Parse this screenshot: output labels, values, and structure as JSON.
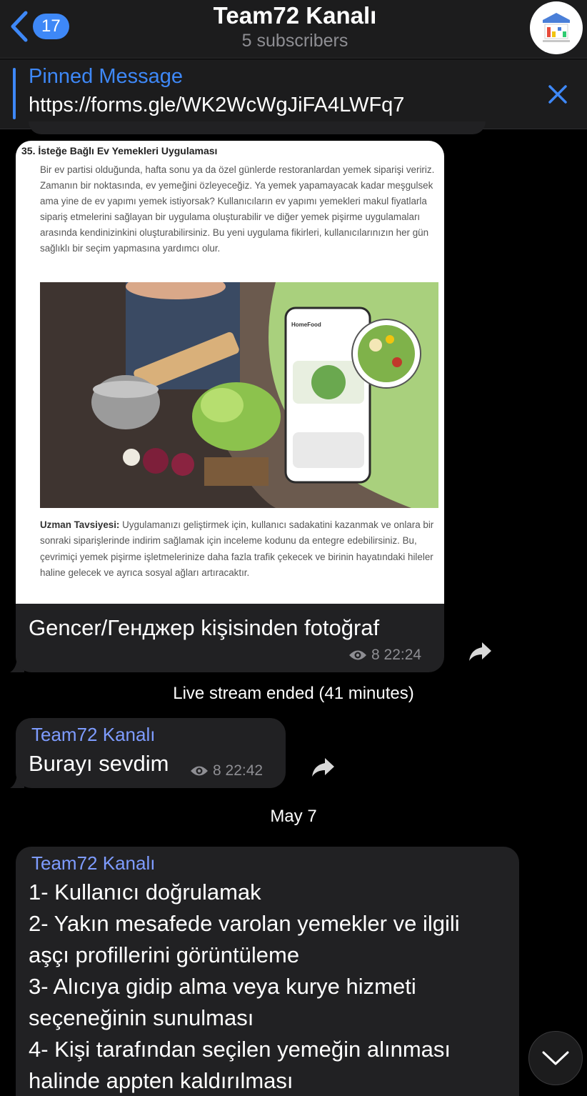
{
  "header": {
    "back_count": "17",
    "title": "Team72 Kanalı",
    "subtitle": "5 subscribers"
  },
  "pinned": {
    "label": "Pinned Message",
    "text": "https://forms.gle/WK2WcWgJiFA4LWFq7"
  },
  "photo_message": {
    "doc": {
      "title": "35. İsteğe Bağlı Ev Yemekleri Uygulaması",
      "body": "Bir ev partisi olduğunda, hafta sonu ya da özel günlerde restoranlardan yemek siparişi veririz. Zamanın bir noktasında, ev yemeğini özleyeceğiz. Ya yemek yapamayacak kadar meşgulsek ama yine de ev yapımı yemek istiyorsak? Kullanıcıların ev yapımı yemekleri makul fiyatlarla sipariş etmelerini sağlayan bir uygulama oluşturabilir ve diğer yemek pişirme uygulamaları arasında kendinizinkini oluşturabilirsiniz. Bu yeni uygulama fikirleri, kullanıcılarınızın her gün sağlıklı bir seçim yapmasına yardımcı olur.",
      "app_name": "HomeFood",
      "tip_label": "Uzman Tavsiyesi:",
      "tip_text": "Uygulamanızı geliştirmek için, kullanıcı sadakatini kazanmak ve onlara bir sonraki siparişlerinde indirim sağlamak için inceleme kodunu da entegre edebilirsiniz. Bu, çevrimiçi yemek pişirme işletmelerinize daha fazla trafik çekecek ve birinin hayatındaki hileler haline gelecek ve ayrıca sosyal ağları artıracaktır."
    },
    "caption": "Gencer/Генджер kişisinden fotoğraf",
    "views": "8",
    "time": "22:24"
  },
  "service_message": "Live stream ended (41 minutes)",
  "message2": {
    "author": "Team72 Kanalı",
    "text": "Burayı sevdim",
    "views": "8",
    "time": "22:42"
  },
  "date_separator": "May 7",
  "message3": {
    "author": "Team72 Kanalı",
    "lines": [
      "1- Kullanıcı doğrulamak",
      "2- Yakın mesafede varolan yemekler ve ilgili",
      "aşçı profillerini görüntüleme",
      "3- Alıcıya gidip alma veya kurye hizmeti",
      "seçeneğinin sunulması",
      "4- Kişi tarafından seçilen yemeğin alınması",
      "halinde appten kaldırılması"
    ]
  },
  "colors": {
    "accent": "#3e88f7",
    "author": "#7e9cff",
    "bubble": "#212123",
    "header": "#1c1c1d"
  }
}
